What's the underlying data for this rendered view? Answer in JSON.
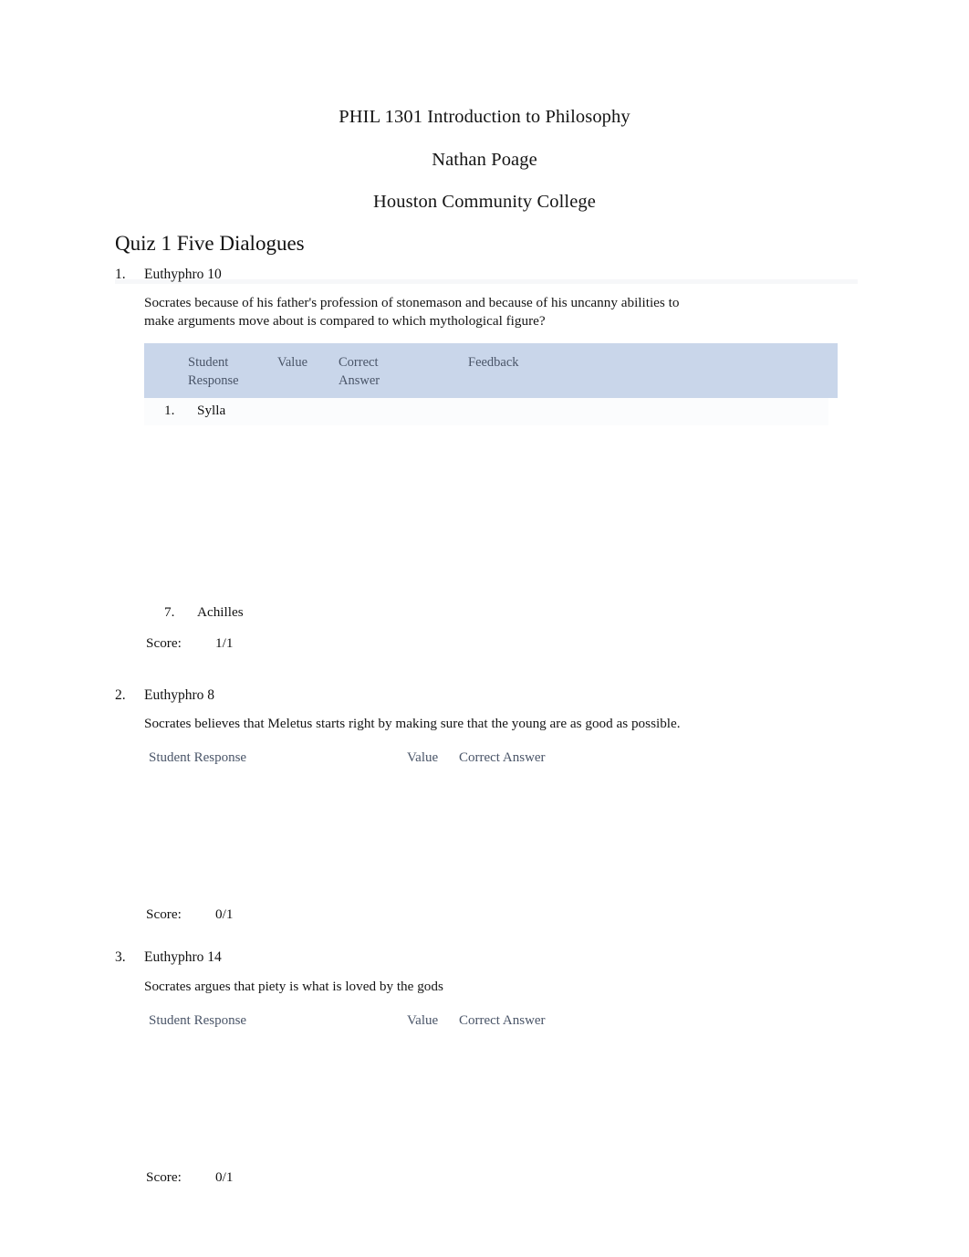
{
  "header": {
    "course": "PHIL 1301 Introduction to Philosophy",
    "instructor": "Nathan Poage",
    "institution": "Houston Community College"
  },
  "quiz_title": "Quiz 1 Five Dialogues",
  "table_headers": {
    "student_response": "Student Response",
    "student_response_wrapped": "Student Respons e",
    "value": "Value",
    "correct_answer": "Correct Answer",
    "correct_answer_wrapped": "Correct Answer",
    "feedback": "Feedback"
  },
  "score_label": "Score:",
  "questions": [
    {
      "number": "1.",
      "title": "Euthyphro 10",
      "prompt": "Socrates because of his father's profession of stonemason and because of his uncanny abilities to make arguments move about is compared to which mythological figure?",
      "options": [
        {
          "number": "1.",
          "text": "Sylla"
        },
        {
          "number": "7.",
          "text": "Achilles"
        }
      ],
      "score": "1/1"
    },
    {
      "number": "2.",
      "title": "Euthyphro 8",
      "prompt": "Socrates believes that Meletus starts right by making sure that the young are as good as possible.",
      "options": [],
      "score": "0/1"
    },
    {
      "number": "3.",
      "title": "Euthyphro 14",
      "prompt": "Socrates argues that piety is what is loved by the gods",
      "options": [],
      "score": "0/1"
    }
  ],
  "colors": {
    "table_header_background": "#c9d6ea",
    "table_header_text": "#4a5568",
    "body_text": "#111111",
    "page_background": "#ffffff"
  }
}
